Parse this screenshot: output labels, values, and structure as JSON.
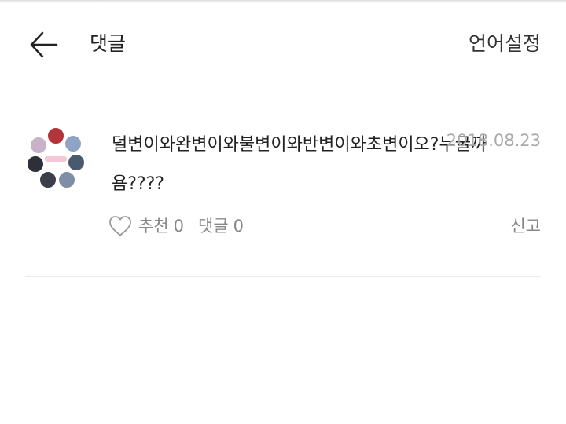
{
  "header": {
    "title": "댓글",
    "language_label": "언어설정",
    "back_icon": "arrow-left-icon"
  },
  "comment": {
    "text": "덜변이와완변이와불변이와반변이와초변이오?누굴까욤????",
    "date": "2018.08.23",
    "avatar_icon": "profile-avatar",
    "like_icon": "heart-outline-icon",
    "like_label": "추천",
    "like_count": "0",
    "reply_label": "댓글",
    "reply_count": "0",
    "report_label": "신고"
  },
  "colors": {
    "text_primary": "#222222",
    "text_secondary": "#888888",
    "date_gray": "#aaaaaa",
    "divider": "#ececec"
  }
}
